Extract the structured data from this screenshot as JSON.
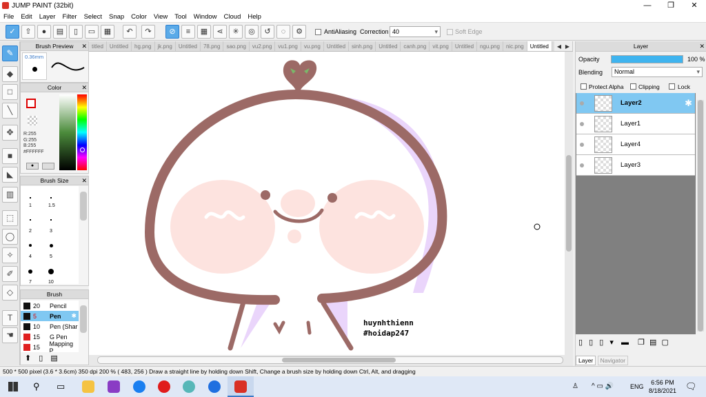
{
  "app": {
    "title": "JUMP PAINT (32bit)"
  },
  "window_controls": {
    "minimize": "—",
    "maximize": "❐",
    "close": "✕"
  },
  "menu": [
    "File",
    "Edit",
    "Layer",
    "Filter",
    "Select",
    "Snap",
    "Color",
    "View",
    "Tool",
    "Window",
    "Cloud",
    "Help"
  ],
  "toolbar": {
    "antialiasing_label": "AntiAliasing",
    "correction_label": "Correction",
    "correction_value": "40",
    "softedge_label": "Soft Edge"
  },
  "brush_preview": {
    "title": "Brush Preview",
    "size": "0.36mm"
  },
  "color_panel": {
    "title": "Color",
    "r": "R:255",
    "g": "G:255",
    "b": "B:255",
    "hex": "#FFFFFF"
  },
  "brush_size": {
    "title": "Brush Size",
    "sizes": [
      "1",
      "1.5",
      "2",
      "3",
      "4",
      "5",
      "7",
      "10"
    ]
  },
  "brush_panel": {
    "title": "Brush",
    "items": [
      {
        "size": "20",
        "name": "Pencil"
      },
      {
        "size": "5",
        "name": "Pen"
      },
      {
        "size": "10",
        "name": "Pen (Shar"
      },
      {
        "size": "15",
        "name": "G Pen"
      },
      {
        "size": "15",
        "name": "Mapping P"
      }
    ]
  },
  "tabs": [
    "titled",
    "Untitled",
    "hg.png",
    "jk.png",
    "Untitled",
    "78.png",
    "sao.png",
    "vu2.png",
    "vu1.png",
    "vu.png",
    "Untitled",
    "sinh.png",
    "Untitled",
    "canh.png",
    "vit.png",
    "Untitled",
    "ngu.png",
    "nic.png",
    "Untitled"
  ],
  "canvas": {
    "watermark_line1": "huynhthienn",
    "watermark_line2": "#hoidap247"
  },
  "layer_panel": {
    "title": "Layer",
    "opacity_label": "Opacity",
    "opacity_value": "100 %",
    "opacity_fraction": 1.0,
    "blending_label": "Blending",
    "blending_value": "Normal",
    "protect_alpha": "Protect Alpha",
    "clipping": "Clipping",
    "lock": "Lock",
    "layers": [
      "Layer2",
      "Layer1",
      "Layer4",
      "Layer3"
    ],
    "bottom_tabs": [
      "Layer",
      "Navigator"
    ]
  },
  "status": {
    "text": "500 * 500 pixel  (3.6 * 3.6cm)  350 dpi  200 %  ( 483, 256 )  Draw a straight line by holding down Shift, Change a brush size by holding down Ctrl, Alt, and dragging"
  },
  "taskbar": {
    "lang": "ENG",
    "time": "6:56 PM",
    "date": "8/18/2021",
    "tray": "^ ▭ 🔊"
  },
  "colors": {
    "accent": "#5aaae8",
    "outline": "#9c6a66",
    "blush": "#fde3df",
    "shadow": "#ead5fb"
  }
}
